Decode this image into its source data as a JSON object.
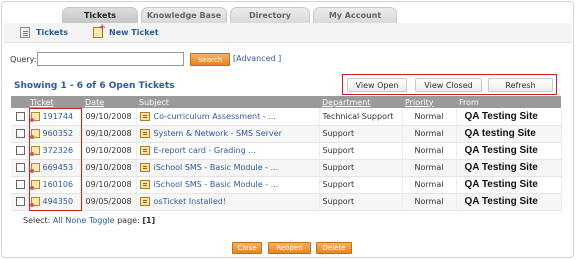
{
  "tabs": [
    {
      "label": "Tickets",
      "active": true
    },
    {
      "label": "Knowledge Base",
      "active": false
    },
    {
      "label": "Directory",
      "active": false
    },
    {
      "label": "My Account",
      "active": false
    }
  ],
  "subnav": {
    "tickets_label": "Tickets",
    "new_ticket_label": "New Ticket"
  },
  "query": {
    "label": "Query:",
    "value": "",
    "search_label": "Search",
    "advanced_label": "[Advanced ]"
  },
  "showing": "Showing  1 - 6 of 6   Open Tickets",
  "view_buttons": {
    "open": "View Open",
    "closed": "View Closed",
    "refresh": "Refresh"
  },
  "table": {
    "headers": {
      "ticket": "Ticket",
      "date": "Date",
      "subject": "Subject",
      "department": "Department",
      "priority": "Priority",
      "from": "From"
    },
    "rows": [
      {
        "ticket": "191744",
        "date": "09/10/2008",
        "subject": "Co-curriculum Assessment - ...",
        "department": "Technical Support",
        "priority": "Normal",
        "from": "QA Testing Site"
      },
      {
        "ticket": "960352",
        "date": "09/10/2008",
        "subject": "System & Network - SMS Server",
        "department": "Support",
        "priority": "Normal",
        "from": "QA testing Site"
      },
      {
        "ticket": "372326",
        "date": "09/10/2008",
        "subject": "E-report card - Grading ...",
        "department": "Support",
        "priority": "Normal",
        "from": "QA Testing Site"
      },
      {
        "ticket": "669453",
        "date": "09/10/2008",
        "subject": "iSchool SMS - Basic Module - ...",
        "department": "Support",
        "priority": "Normal",
        "from": "QA Testing Site"
      },
      {
        "ticket": "160106",
        "date": "09/10/2008",
        "subject": "iSchool SMS - Basic Module - ...",
        "department": "Support",
        "priority": "Normal",
        "from": "QA Testing Site"
      },
      {
        "ticket": "494350",
        "date": "09/05/2008",
        "subject": "osTicket Installed!",
        "department": "Support",
        "priority": "Normal",
        "from": "QA Testing Site"
      }
    ]
  },
  "select": {
    "prefix": "Select:",
    "all": "All",
    "none": "None",
    "toggle": "Toggle",
    "page_label": "page:",
    "page": "[1]"
  },
  "actions": {
    "close": "Close",
    "reopen": "Reopen",
    "delete": "Delete"
  },
  "colors": {
    "link": "#2e5c9a",
    "accent": "#e58420",
    "highlight": "#cc1f1f",
    "header": "#9a9a9a"
  }
}
